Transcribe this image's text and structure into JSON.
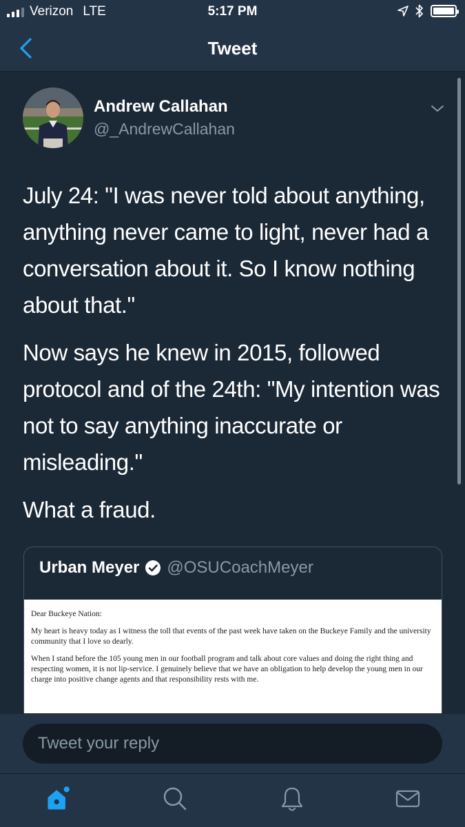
{
  "status_bar": {
    "carrier": "Verizon",
    "network": "LTE",
    "time": "5:17 PM",
    "icons": [
      "location-arrow-icon",
      "bluetooth-icon",
      "battery-icon"
    ]
  },
  "nav": {
    "title": "Tweet",
    "back_icon": "chevron-left-icon"
  },
  "tweet": {
    "author_name": "Andrew Callahan",
    "author_handle": "@_AndrewCallahan",
    "paragraphs": [
      "July 24: \"I was never told about anything, anything never came to light, never had a conversation about it. So I know nothing about that.\"",
      "Now says he knew in 2015, followed protocol and of the 24th: \"My intention was not to say anything inaccurate or misleading.\"",
      "What a fraud."
    ]
  },
  "quoted_tweet": {
    "author_name": "Urban Meyer",
    "author_handle": "@OSUCoachMeyer",
    "verified": true,
    "image_text": [
      "Dear Buckeye Nation:",
      "My heart is heavy today as I witness the toll that events of the past week have taken on the Buckeye Family and the university community that I love so dearly.",
      "When I stand before the 105 young men in our football program and talk about core values and doing the right thing and respecting women, it is not lip-service.  I genuinely believe that we have an obligation to help develop the young men in our charge into positive change agents and that responsibility rests with me."
    ]
  },
  "reply": {
    "placeholder": "Tweet your reply"
  },
  "tabs": [
    {
      "name": "home",
      "icon": "home-icon",
      "active": true
    },
    {
      "name": "search",
      "icon": "search-icon",
      "active": false
    },
    {
      "name": "notifications",
      "icon": "bell-icon",
      "active": false
    },
    {
      "name": "messages",
      "icon": "mail-icon",
      "active": false
    }
  ],
  "colors": {
    "background": "#1b2836",
    "bar": "#243447",
    "accent": "#1da1f2",
    "secondary_text": "#8899a6"
  }
}
